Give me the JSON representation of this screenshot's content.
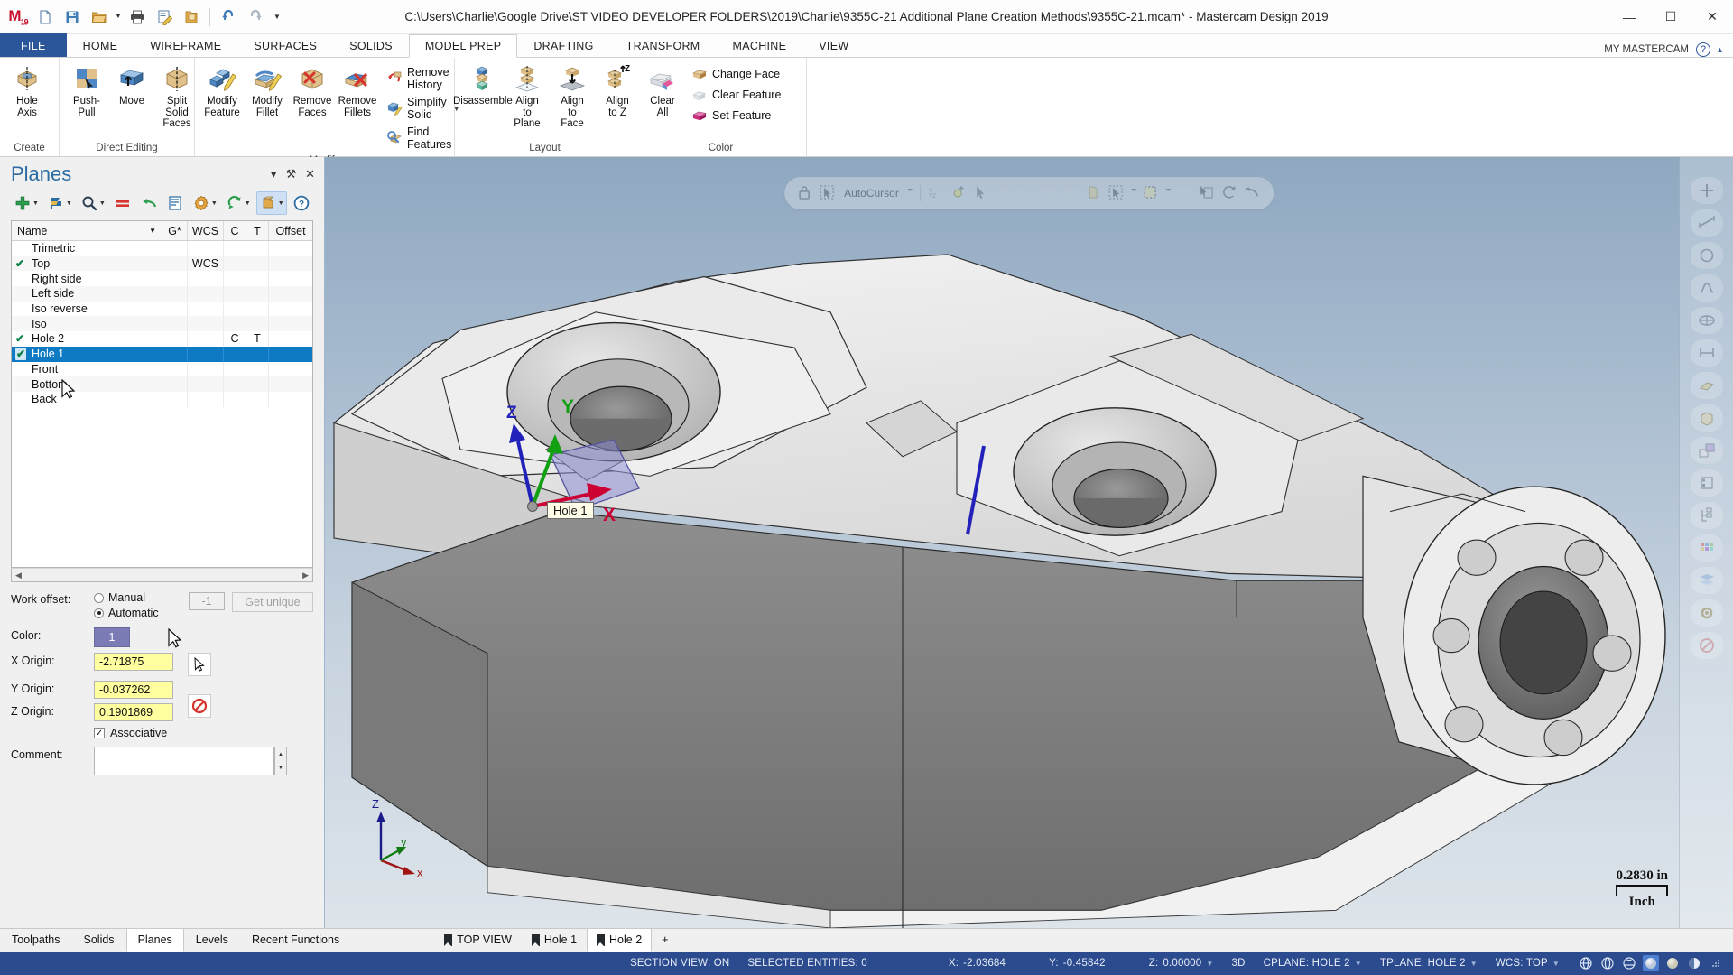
{
  "window": {
    "title": "C:\\Users\\Charlie\\Google Drive\\ST VIDEO DEVELOPER FOLDERS\\2019\\Charlie\\9355C-21 Additional Plane Creation Methods\\9355C-21.mcam* - Mastercam Design 2019",
    "minimize": "—",
    "maximize": "☐",
    "close": "✕",
    "logo": "M",
    "logo_sub": "19"
  },
  "quick_access": [
    {
      "name": "new-file-icon",
      "tip": "New"
    },
    {
      "name": "save-icon",
      "tip": "Save"
    },
    {
      "name": "open-folder-icon",
      "tip": "Open"
    },
    {
      "name": "print-icon",
      "tip": "Print"
    },
    {
      "name": "edit-page-icon",
      "tip": "Print Preview"
    },
    {
      "name": "folder-copy-icon",
      "tip": "Zip2Go"
    },
    {
      "name": "undo-icon",
      "tip": "Undo"
    },
    {
      "name": "redo-icon",
      "tip": "Redo"
    },
    {
      "name": "customize-caret-icon",
      "tip": "Customize"
    }
  ],
  "ribbon_tabs": [
    {
      "label": "FILE",
      "active": false,
      "kind": "file"
    },
    {
      "label": "HOME",
      "active": false
    },
    {
      "label": "WIREFRAME",
      "active": false
    },
    {
      "label": "SURFACES",
      "active": false
    },
    {
      "label": "SOLIDS",
      "active": false
    },
    {
      "label": "MODEL PREP",
      "active": true
    },
    {
      "label": "DRAFTING",
      "active": false
    },
    {
      "label": "TRANSFORM",
      "active": false
    },
    {
      "label": "MACHINE",
      "active": false
    },
    {
      "label": "VIEW",
      "active": false
    }
  ],
  "ribbon_right": {
    "account": "MY MASTERCAM",
    "help": "?",
    "collapse": "▴"
  },
  "ribbon_groups": [
    {
      "name": "Create",
      "buttons": [
        {
          "label": "Hole\nAxis",
          "icon": "hole-axis-icon"
        }
      ],
      "small": []
    },
    {
      "name": "Direct Editing",
      "buttons": [
        {
          "label": "Push-Pull",
          "icon": "push-pull-icon"
        },
        {
          "label": "Move",
          "icon": "move-icon"
        },
        {
          "label": "Split Solid\nFaces",
          "icon": "split-solid-faces-icon"
        }
      ],
      "small": []
    },
    {
      "name": "Modify",
      "buttons": [
        {
          "label": "Modify\nFeature",
          "icon": "modify-feature-icon"
        },
        {
          "label": "Modify\nFillet",
          "icon": "modify-fillet-icon"
        },
        {
          "label": "Remove\nFaces",
          "icon": "remove-faces-icon"
        },
        {
          "label": "Remove\nFillets",
          "icon": "remove-fillets-icon"
        }
      ],
      "small": [
        {
          "label": "Remove History",
          "icon": "remove-history-icon",
          "caret": false
        },
        {
          "label": "Simplify Solid",
          "icon": "simplify-solid-icon",
          "caret": true
        },
        {
          "label": "Find Features",
          "icon": "find-features-icon",
          "caret": false
        }
      ]
    },
    {
      "name": "Layout",
      "buttons": [
        {
          "label": "Disassemble",
          "icon": "disassemble-icon"
        },
        {
          "label": "Align to\nPlane",
          "icon": "align-to-plane-icon"
        },
        {
          "label": "Align\nto Face",
          "icon": "align-to-face-icon"
        },
        {
          "label": "Align\nto Z",
          "icon": "align-to-z-icon"
        }
      ],
      "small": []
    },
    {
      "name": "Color",
      "buttons": [
        {
          "label": "Clear\nAll",
          "icon": "clear-all-icon"
        }
      ],
      "small": [
        {
          "label": "Change Face",
          "icon": "change-face-icon",
          "caret": false
        },
        {
          "label": "Clear Feature",
          "icon": "clear-feature-icon",
          "caret": false
        },
        {
          "label": "Set Feature",
          "icon": "set-feature-icon",
          "caret": false
        }
      ]
    }
  ],
  "panel": {
    "title": "Planes",
    "header_controls": [
      {
        "name": "panel-dropdown-icon",
        "glyph": "▾"
      },
      {
        "name": "panel-pin-icon",
        "glyph": "⚒"
      },
      {
        "name": "panel-close-icon",
        "glyph": "✕"
      }
    ],
    "toolbar": [
      {
        "name": "add-plane-button",
        "icon": "plus-icon",
        "caret": true,
        "active": false
      },
      {
        "name": "select-plane-button",
        "icon": "flag-icon",
        "caret": true,
        "active": false
      },
      {
        "name": "find-plane-button",
        "icon": "search-icon",
        "caret": true,
        "active": false
      },
      {
        "name": "equal-button",
        "icon": "equals-icon",
        "caret": false,
        "active": false
      },
      {
        "name": "undo-plane-button",
        "icon": "undo-arrow-icon",
        "caret": false,
        "active": false
      },
      {
        "name": "list-properties-button",
        "icon": "list-icon",
        "caret": false,
        "active": false
      },
      {
        "name": "plane-settings-button",
        "icon": "gear-icon",
        "caret": true,
        "active": false
      },
      {
        "name": "refresh-button",
        "icon": "refresh-icon",
        "caret": true,
        "active": false
      },
      {
        "name": "display-plane-button",
        "icon": "plane-box-icon",
        "caret": true,
        "active": true
      },
      {
        "name": "help-button",
        "icon": "help-icon",
        "caret": false,
        "active": false
      }
    ],
    "columns": [
      {
        "key": "name",
        "label": "Name"
      },
      {
        "key": "g",
        "label": "G*"
      },
      {
        "key": "wcs",
        "label": "WCS"
      },
      {
        "key": "c",
        "label": "C"
      },
      {
        "key": "t",
        "label": "T"
      },
      {
        "key": "offset",
        "label": "Offset"
      }
    ],
    "rows": [
      {
        "check": false,
        "name": "Trimetric",
        "g": "",
        "wcs": "",
        "c": "",
        "t": "",
        "offset": "",
        "selected": false
      },
      {
        "check": true,
        "name": "Top",
        "g": "",
        "wcs": "WCS",
        "c": "",
        "t": "",
        "offset": "",
        "selected": false
      },
      {
        "check": false,
        "name": "Right side",
        "g": "",
        "wcs": "",
        "c": "",
        "t": "",
        "offset": "",
        "selected": false
      },
      {
        "check": false,
        "name": "Left side",
        "g": "",
        "wcs": "",
        "c": "",
        "t": "",
        "offset": "",
        "selected": false
      },
      {
        "check": false,
        "name": "Iso reverse",
        "g": "",
        "wcs": "",
        "c": "",
        "t": "",
        "offset": "",
        "selected": false
      },
      {
        "check": false,
        "name": "Iso",
        "g": "",
        "wcs": "",
        "c": "",
        "t": "",
        "offset": "",
        "selected": false
      },
      {
        "check": true,
        "name": "Hole 2",
        "g": "",
        "wcs": "",
        "c": "C",
        "t": "T",
        "offset": "",
        "selected": false
      },
      {
        "check": true,
        "name": "Hole 1",
        "g": "",
        "wcs": "",
        "c": "",
        "t": "",
        "offset": "",
        "selected": true
      },
      {
        "check": false,
        "name": "Front",
        "g": "",
        "wcs": "",
        "c": "",
        "t": "",
        "offset": "",
        "selected": false
      },
      {
        "check": false,
        "name": "Bottom",
        "g": "",
        "wcs": "",
        "c": "",
        "t": "",
        "offset": "",
        "selected": false
      },
      {
        "check": false,
        "name": "Back",
        "g": "",
        "wcs": "",
        "c": "",
        "t": "",
        "offset": "",
        "selected": false
      }
    ],
    "form": {
      "work_offset_label": "Work offset:",
      "manual_label": "Manual",
      "automatic_label": "Automatic",
      "manual_selected": false,
      "automatic_selected": true,
      "offset_value": "-1",
      "get_unique_label": "Get unique",
      "color_label": "Color:",
      "color_value": "1",
      "color_hex": "#7b7bb5",
      "x_origin_label": "X Origin:",
      "x_origin_value": "-2.71875",
      "y_origin_label": "Y Origin:",
      "y_origin_value": "-0.037262",
      "z_origin_label": "Z Origin:",
      "z_origin_value": "0.1901869",
      "associative_label": "Associative",
      "associative_checked": true,
      "comment_label": "Comment:",
      "comment_value": "",
      "select-origin-icon": "cursor-select-icon",
      "no-entry-icon": "no-entry-icon"
    }
  },
  "viewport": {
    "autocursor_label": "AutoCursor",
    "toolbar_icons": [
      "lock-icon",
      "autocursor-icon",
      "caret-down-icon",
      "endpoint-icon",
      "origin-point-icon",
      "cursor-icon",
      "filter-v-icon",
      "arc-icon",
      "line-icon",
      "face-icon",
      "solid-face-icon",
      "select-window-icon",
      "caret-down-icon",
      "marquee-icon",
      "caret-down-icon",
      "unselect-icon",
      "verify-select-icon",
      "rotate-icon",
      "undo-select-icon"
    ],
    "plane_label": "Hole 1",
    "axis_x": "X",
    "axis_y": "Y",
    "axis_z": "Z",
    "gnomon_x": "x",
    "gnomon_y": "y",
    "gnomon_z": "Z",
    "scale_value": "0.2830 in",
    "scale_unit": "Inch",
    "right_rail": [
      "add-point-icon",
      "dimension-icon",
      "circle-icon",
      "spline-icon",
      "surface-icon",
      "distance-icon",
      "hatch-icon",
      "stock-icon",
      "plane-copy-icon",
      "levels-icon",
      "tree-icon",
      "color-grid-icon",
      "layers-icon",
      "settings-gear-icon",
      "no-entry-rail-icon"
    ]
  },
  "bottom_tabs": [
    {
      "label": "Toolpaths",
      "active": false
    },
    {
      "label": "Solids",
      "active": false
    },
    {
      "label": "Planes",
      "active": true
    },
    {
      "label": "Levels",
      "active": false
    },
    {
      "label": "Recent Functions",
      "active": false
    }
  ],
  "view_tabs": [
    {
      "label": "TOP VIEW",
      "active": false
    },
    {
      "label": "Hole 1",
      "active": false
    },
    {
      "label": "Hole 2",
      "active": true
    },
    {
      "label": "+",
      "active": false,
      "plain": true
    }
  ],
  "status_bar": {
    "section_view": "SECTION VIEW: ON",
    "selected_entities": "SELECTED ENTITIES: 0",
    "x_label": "X:",
    "x_value": "-2.03684",
    "y_label": "Y:",
    "y_value": "-0.45842",
    "z_label": "Z:",
    "z_value": "0.00000",
    "mode": "3D",
    "cplane": "CPLANE: HOLE 2",
    "tplane": "TPLANE: HOLE 2",
    "wcs": "WCS: TOP",
    "icons": [
      "wireframe-globe-icon",
      "hidden-line-globe-icon",
      "no-hidden-globe-icon",
      "shaded-sphere-icon",
      "shaded-solid-icon",
      "half-shaded-icon",
      "resize-grip-icon"
    ]
  }
}
